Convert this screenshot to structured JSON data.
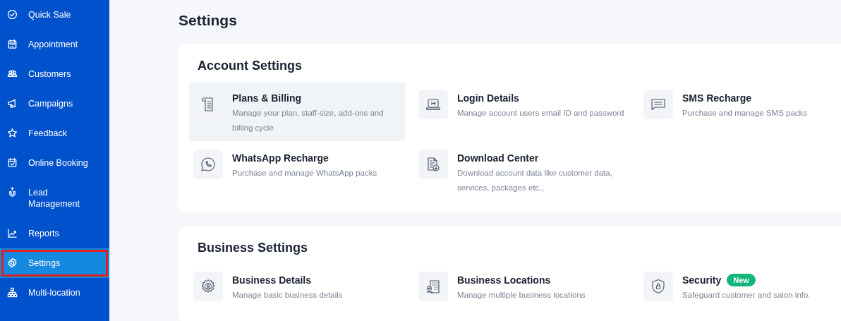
{
  "sidebar": {
    "items": [
      {
        "label": "Quick Sale",
        "selected": false
      },
      {
        "label": "Appointment",
        "selected": false
      },
      {
        "label": "Customers",
        "selected": false
      },
      {
        "label": "Campaigns",
        "selected": false
      },
      {
        "label": "Feedback",
        "selected": false
      },
      {
        "label": "Online Booking",
        "selected": false
      },
      {
        "label": "Lead Management",
        "selected": false
      },
      {
        "label": "Reports",
        "selected": false
      },
      {
        "label": "Settings",
        "selected": true
      },
      {
        "label": "Multi-location",
        "selected": false
      }
    ]
  },
  "page_title": "Settings",
  "sections": [
    {
      "title": "Account Settings",
      "items": [
        {
          "title": "Plans & Billing",
          "description": "Manage your plan, staff-size, add-ons and billing cycle",
          "hovered": true
        },
        {
          "title": "Login Details",
          "description": "Manage account users email ID and password",
          "hovered": false
        },
        {
          "title": "SMS Recharge",
          "description": "Purchase and manage SMS packs",
          "hovered": false
        },
        {
          "title": "WhatsApp Recharge",
          "description": "Purchase and manage WhatsApp packs",
          "hovered": false
        },
        {
          "title": "Download Center",
          "description": "Download account data like customer data, services, packages etc.,",
          "hovered": false
        }
      ]
    },
    {
      "title": "Business Settings",
      "items": [
        {
          "title": "Business Details",
          "description": "Manage basic business details",
          "hovered": false
        },
        {
          "title": "Business Locations",
          "description": "Manage multiple business locations",
          "hovered": false
        },
        {
          "title": "Security",
          "badge": "New",
          "description": "Safeguard customer and salon info.",
          "hovered": false
        }
      ]
    }
  ]
}
